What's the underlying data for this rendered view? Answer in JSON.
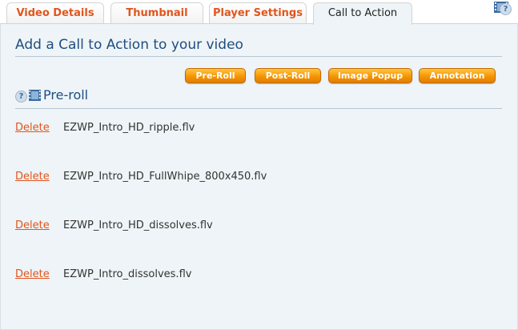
{
  "tabs": [
    {
      "label": "Video Details",
      "active": false
    },
    {
      "label": "Thumbnail",
      "active": false
    },
    {
      "label": "Player Settings",
      "active": false
    },
    {
      "label": "Call to Action",
      "active": true
    }
  ],
  "help_glyph": "?",
  "panel": {
    "title": "Add a Call to Action to your video",
    "buttons": {
      "preroll": "Pre-Roll",
      "postroll": "Post-Roll",
      "image_popup": "Image Popup",
      "annotation": "Annotation"
    },
    "section_title": "Pre-roll",
    "items": [
      {
        "delete_label": "Delete",
        "file": "EZWP_Intro_HD_ripple.flv"
      },
      {
        "delete_label": "Delete",
        "file": "EZWP_Intro_HD_FullWhipe_800x450.flv"
      },
      {
        "delete_label": "Delete",
        "file": "EZWP_Intro_HD_dissolves.flv"
      },
      {
        "delete_label": "Delete",
        "file": "EZWP_Intro_dissolves.flv"
      }
    ]
  },
  "colors": {
    "tab_inactive_text": "#e2551c",
    "accent_orange": "#f39200",
    "title_blue": "#1f4d80",
    "panel_bg": "#eef4f7"
  },
  "icons": [
    "film-icon",
    "help-icon"
  ]
}
